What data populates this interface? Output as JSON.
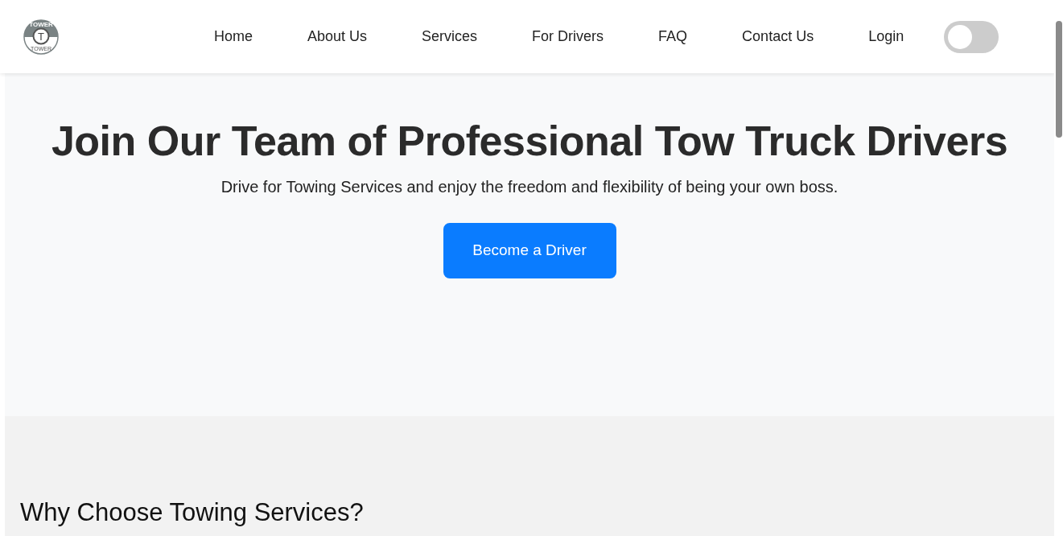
{
  "logo": {
    "top_text": "TOWER",
    "letter": "T",
    "bottom_text": "TOWER"
  },
  "nav": [
    {
      "label": "Home"
    },
    {
      "label": "About Us"
    },
    {
      "label": "Services"
    },
    {
      "label": "For Drivers"
    },
    {
      "label": "FAQ"
    },
    {
      "label": "Contact Us"
    },
    {
      "label": "Login"
    }
  ],
  "theme_toggle": {
    "on": false
  },
  "hero": {
    "title": "Join Our Team of Professional Tow Truck Drivers",
    "subtitle": "Drive for Towing Services and enjoy the freedom and flexibility of being your own boss.",
    "button": "Become a Driver"
  },
  "why_section": {
    "heading": "Why Choose Towing Services?"
  }
}
